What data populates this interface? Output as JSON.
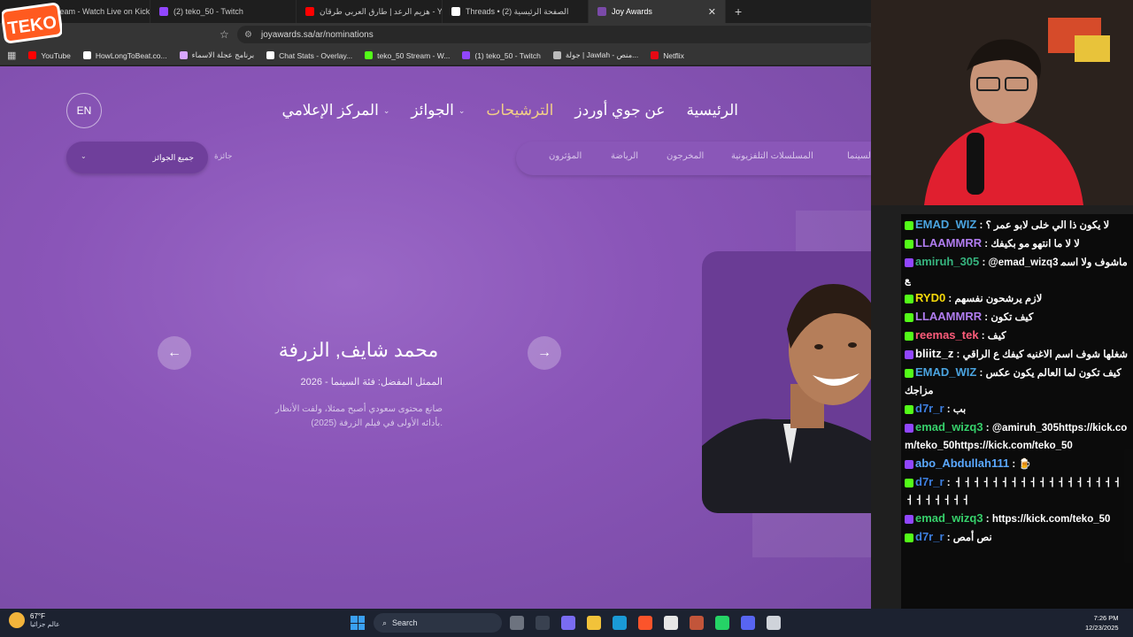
{
  "browser": {
    "tabs": [
      {
        "label": "Stream - Watch Live on Kick",
        "color": "#53fc18"
      },
      {
        "label": "(2) teko_50 - Twitch",
        "color": "#9146ff"
      },
      {
        "label": "هزيم الرعد | طارق العربي طرقان - YouTube",
        "color": "#ff0000"
      },
      {
        "label": "Threads • (2) الصفحة الرئيسية",
        "color": "#ffffff"
      },
      {
        "label": "Joy Awards",
        "color": "#7a4aa8",
        "active": true
      }
    ],
    "url": "joyawards.sa/ar/nominations",
    "bookmarks": [
      {
        "label": "YouTube",
        "color": "#ff0000"
      },
      {
        "label": "HowLongToBeat.co...",
        "color": "#ffffff"
      },
      {
        "label": "برنامج عجلة الاسماء",
        "color": "#d8a7ff"
      },
      {
        "label": "Chat Stats - Overlay...",
        "color": "#ffffff"
      },
      {
        "label": "teko_50 Stream - W...",
        "color": "#53fc18"
      },
      {
        "label": "(1) teko_50 - Twitch",
        "color": "#9146ff"
      },
      {
        "label": "جولة | Jawlah - منص...",
        "color": "#bbbbbb"
      },
      {
        "label": "Netflix",
        "color": "#e50914"
      }
    ]
  },
  "site": {
    "nav": [
      {
        "label": "الرئيسية"
      },
      {
        "label": "عن جوي أوردز"
      },
      {
        "label": "الترشيحات",
        "active": true
      },
      {
        "label": "الجوائز",
        "caret": true
      },
      {
        "label": "المركز الإعلامي",
        "caret": true
      }
    ],
    "lang_button": "EN",
    "award_filter_label": "جائزة",
    "award_filter_value": "جميع الجوائز",
    "categories": [
      "السينما",
      "المسلسلات التلفزيونية",
      "المخرجون",
      "الرياضة",
      "المؤثرون"
    ],
    "nominee": {
      "name": "محمد شايف, الزرفة",
      "category": "الممثل المفضل: فئة السينما - 2026",
      "description": "صانع محتوى سعودي أصبح ممثلا، ولفت الأنظار بأدائه الأولى في فيلم الزرفة (2025)."
    }
  },
  "chat": {
    "messages": [
      {
        "user": "EMAD_WIZ",
        "color": "#4aa3df",
        "text": "لا يكون ذا الي خلى لابو عمر ؟"
      },
      {
        "user": "LLAAMMRR",
        "color": "#b07cf0",
        "text": "لا لا ما انتهو مو بكيفك"
      },
      {
        "user": "amiruh_305",
        "color": "#36b37e",
        "text": "@emad_wizq3 ماشوف ولا اسمع"
      },
      {
        "user": "RYD0",
        "color": "#f5d90a",
        "text": "لازم يرشحون نفسهم"
      },
      {
        "user": "LLAAMMRR",
        "color": "#b07cf0",
        "text": "كيف تكون"
      },
      {
        "user": "reemas_tek",
        "color": "#ff5c7a",
        "text": "كيف"
      },
      {
        "user": "bliitz_z",
        "color": "#ffffff",
        "text": "شغلها شوف اسم الاغنيه كيفك ع الراقي"
      },
      {
        "user": "EMAD_WIZ",
        "color": "#4aa3df",
        "text": "كيف تكون لما العالم يكون عكس مزاجك"
      },
      {
        "user": "d7r_r",
        "color": "#3d7fe0",
        "text": "بب"
      },
      {
        "user": "emad_wizq3",
        "color": "#36d06b",
        "text": "@amiruh_305https://kick.com/teko_50https://kick.com/teko_50"
      },
      {
        "user": "abo_Abdullah111",
        "color": "#5aa8ff",
        "text": "🍺"
      },
      {
        "user": "d7r_r",
        "color": "#3d7fe0",
        "text": "ㅓㅓㅓㅓㅓㅓㅓㅓㅓㅓㅓㅓㅓㅓㅓㅓㅓㅓㅓㅓㅓㅓㅓㅓㅓ"
      },
      {
        "user": "emad_wizq3",
        "color": "#36d06b",
        "text": "https://kick.com/teko_50"
      },
      {
        "user": "d7r_r",
        "color": "#3d7fe0",
        "text": "نص أمص"
      }
    ]
  },
  "taskbar": {
    "temperature": "67°F",
    "weather_desc": "عالم جزائيا",
    "search_placeholder": "Search",
    "time": "7:26 PM",
    "date": "12/23/2025"
  },
  "overlay": {
    "logo_text": "TEKO"
  }
}
